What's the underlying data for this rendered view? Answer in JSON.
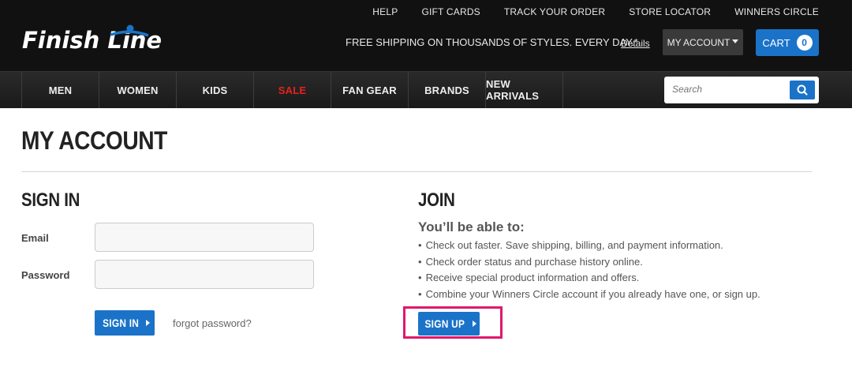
{
  "header": {
    "util_links": [
      "HELP",
      "GIFT CARDS",
      "TRACK YOUR ORDER",
      "STORE LOCATOR",
      "WINNERS CIRCLE"
    ],
    "logo_text": "Finish Line",
    "promo": "FREE SHIPPING ON THOUSANDS OF STYLES. EVERY DAY.*",
    "promo_link": "Details",
    "my_account_label": "MY ACCOUNT",
    "cart_label": "CART",
    "cart_count": "0"
  },
  "nav": {
    "items": [
      "MEN",
      "WOMEN",
      "KIDS",
      "SALE",
      "FAN GEAR",
      "BRANDS",
      "NEW ARRIVALS"
    ],
    "sale_color": "#e8211c"
  },
  "search": {
    "placeholder": "Search"
  },
  "page": {
    "title": "MY ACCOUNT"
  },
  "sign_in": {
    "title": "SIGN IN",
    "email_label": "Email",
    "password_label": "Password",
    "button_label": "SIGN IN",
    "forgot_link": "forgot password?"
  },
  "join": {
    "title": "JOIN",
    "subtitle": "You’ll be able to:",
    "benefits": [
      "Check out faster.  Save shipping, billing, and payment information.",
      "Check order status and purchase history online.",
      "Receive special product information and offers.",
      "Combine your Winners Circle account if you already have one, or sign up."
    ],
    "button_label": "SIGN UP"
  },
  "colors": {
    "brand_blue": "#1a73c8",
    "highlight": "#e0186c",
    "header_bg": "#111111"
  }
}
